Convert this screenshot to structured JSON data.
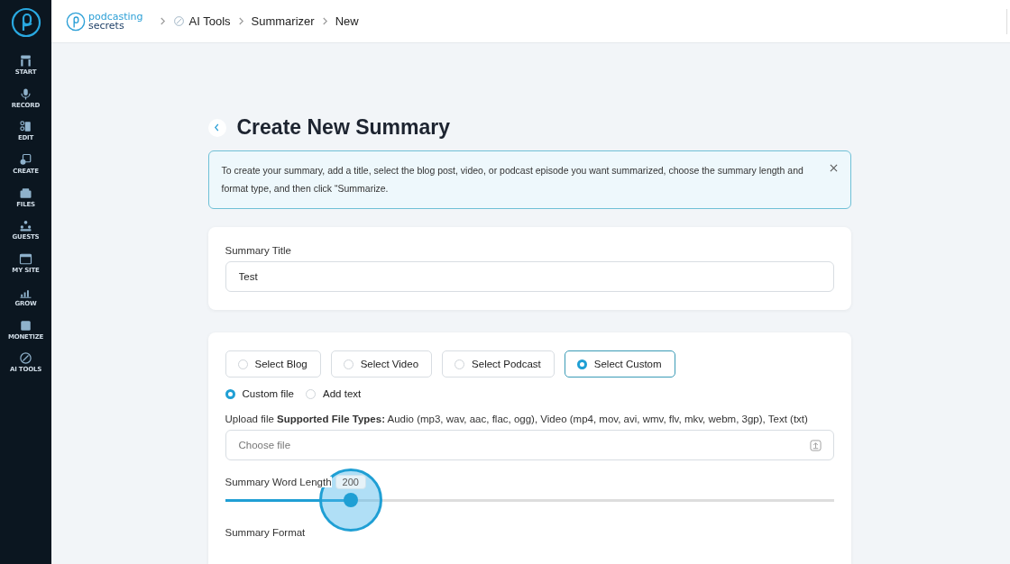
{
  "sidebar": {
    "items": [
      {
        "label": "START",
        "selected": false
      },
      {
        "label": "RECORD",
        "selected": false
      },
      {
        "label": "EDIT",
        "selected": false
      },
      {
        "label": "CREATE",
        "selected": false
      },
      {
        "label": "FILES",
        "selected": false
      },
      {
        "label": "GUESTS",
        "selected": false
      },
      {
        "label": "MY SITE",
        "selected": false
      },
      {
        "label": "GROW",
        "selected": false
      },
      {
        "label": "MONETIZE",
        "selected": false
      },
      {
        "label": "AI TOOLS",
        "selected": false
      }
    ]
  },
  "header": {
    "logo_lines": [
      "podcasting",
      "secrets"
    ],
    "breadcrumbs": [
      "AI Tools",
      "Summarizer",
      "New"
    ]
  },
  "page": {
    "title": "Create New Summary",
    "notice": "To create your summary, add a title, select the blog post, video, or podcast episode you want summarized, choose the summary length and format type, and then click “Summarize.",
    "title_field": {
      "label": "Summary Title",
      "value": "Test"
    },
    "sources": [
      {
        "label": "Select Blog",
        "selected": false
      },
      {
        "label": "Select Video",
        "selected": false
      },
      {
        "label": "Select Podcast",
        "selected": false
      },
      {
        "label": "Select Custom",
        "selected": true
      }
    ],
    "input_modes": [
      {
        "label": "Custom file",
        "selected": true
      },
      {
        "label": "Add text",
        "selected": false
      }
    ],
    "upload": {
      "label": "Upload file **Supported File Types:** Audio (mp3, wav, aac, flac, ogg), Video (mp4, mov, avi, wmv, flv, mkv, webm, 3gp), Text (txt)",
      "placeholder": "Choose file"
    },
    "word_length": {
      "label": "Summary Word Length",
      "reading": "200",
      "level": 0.206
    },
    "format": {
      "label": "Summary Format"
    }
  }
}
